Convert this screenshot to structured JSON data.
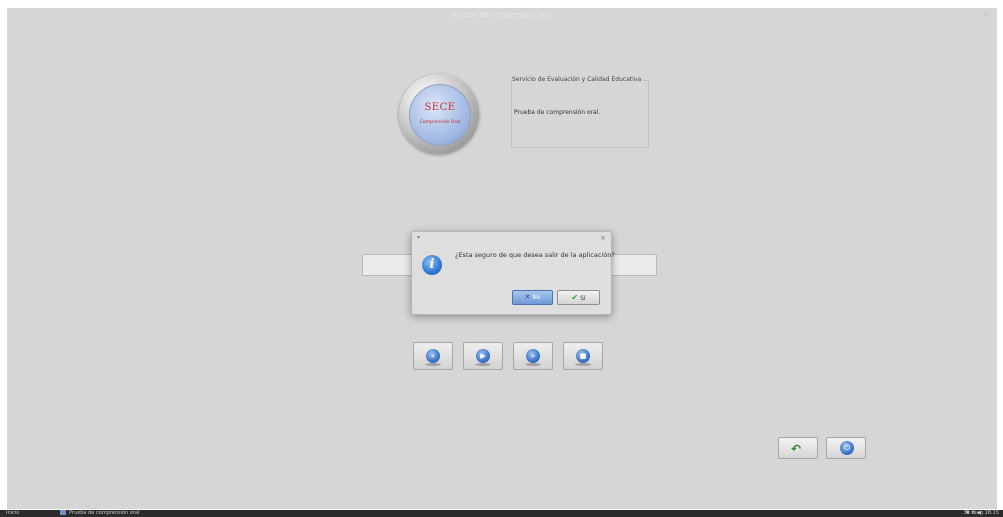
{
  "window": {
    "title": "Prueba de comprensión oral",
    "min_label": "–",
    "close_label": "×"
  },
  "logo": {
    "title": "SECE",
    "subtitle": "Comprensión Oral"
  },
  "info": {
    "legend": "Servicio de Evaluación y Calidad Educativa",
    "text": "Prueba de comprensión oral."
  },
  "dialog": {
    "menu_label": "▾",
    "close_label": "×",
    "icon": "i",
    "message": "¿Esta seguro de que desea salir de la aplicación?",
    "no_label": "No",
    "yes_label": "Sí"
  },
  "player": {
    "rewind_icon": "«",
    "play_icon": "▶",
    "forward_icon": "»",
    "stop_icon": "■"
  },
  "bottom": {
    "back_icon": "↶",
    "power_icon": "⏻"
  },
  "taskbar": {
    "start_label": "Inicio",
    "app_label": "Prueba de comprensión oral",
    "tray": "✱ ⇅ ◀)",
    "clock": "31 mar, 18:15"
  }
}
